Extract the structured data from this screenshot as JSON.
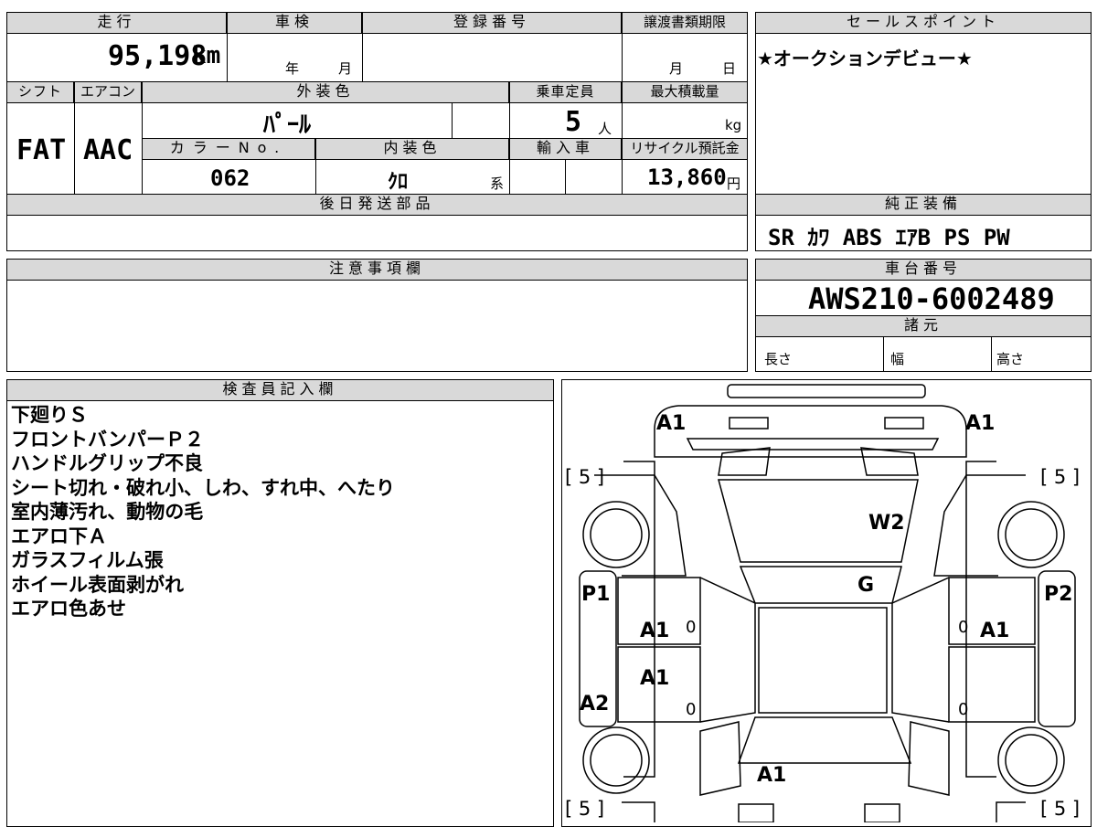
{
  "summary": {
    "mileage_label": "走行",
    "mileage_value": "95,198",
    "mileage_unit": "km",
    "shaken_label": "車検",
    "shaken_year": "年",
    "shaken_month": "月",
    "reg_label": "登録番号",
    "transfer_label": "譲渡書類期限",
    "transfer_month": "月",
    "transfer_day": "日",
    "shift_label": "シフト",
    "shift_value": "FAT",
    "ac_label": "エアコン",
    "ac_value": "AAC",
    "ext_color_label": "外装色",
    "ext_color_value": "ﾊﾟｰﾙ",
    "capacity_label": "乗車定員",
    "capacity_value": "5",
    "capacity_unit": "人",
    "maxload_label": "最大積載量",
    "maxload_unit": "kg",
    "colorno_label": "カラーNo.",
    "colorno_value": "062",
    "int_color_label": "内装色",
    "int_color_value": "ｸﾛ",
    "int_color_suffix": "系",
    "import_label": "輸入車",
    "recycle_label": "リサイクル預託金",
    "recycle_value": "13,860",
    "recycle_unit": "円",
    "later_parts_label": "後日発送部品"
  },
  "sales": {
    "label": "セールスポイント",
    "text": "★オークションデビュー★"
  },
  "equipment": {
    "label": "純正装備",
    "items": "SR ｶﾜ ABS ｴｱB PS PW"
  },
  "notes": {
    "label": "注意事項欄"
  },
  "chassis": {
    "label": "車台番号",
    "value": "AWS210-6002489"
  },
  "specs": {
    "label": "諸元",
    "length": "長さ",
    "width": "幅",
    "height": "高さ"
  },
  "inspector": {
    "label": "検査員記入欄",
    "lines": [
      "下廻りＳ",
      "フロントバンパーＰ２",
      "ハンドルグリップ不良",
      "シート切れ・破れ小、しわ、すれ中、へたり",
      "室内薄汚れ、動物の毛",
      "エアロ下Ａ",
      "ガラスフィルム張",
      "ホイール表面剥がれ",
      "エアロ色あせ"
    ]
  },
  "diagram": {
    "tire_fl": "[ 5 ]",
    "tire_fr": "[ 5 ]",
    "tire_rl": "[ 5 ]",
    "tire_rr": "[ 5 ]",
    "a1_front_left": "A1",
    "a1_front_right": "A1",
    "w2_windshield": "W2",
    "g_roof_glass": "G",
    "p1_left": "P1",
    "p2_right": "P2",
    "a2_left": "A2",
    "a1_door_fl": "A1",
    "a1_door_rl": "A1",
    "a1_door_fr": "A1",
    "a1_rear": "A1",
    "zero_1": "0",
    "zero_2": "0",
    "zero_3": "0",
    "zero_4": "0"
  }
}
